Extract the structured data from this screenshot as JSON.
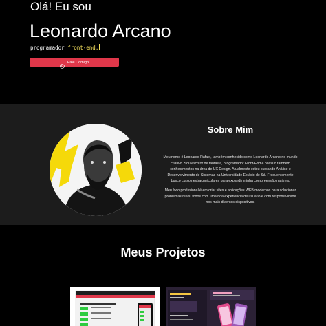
{
  "hero": {
    "greeting": "Olá! Eu sou",
    "name": "Leonardo Arcano",
    "typed_prefix": "programador",
    "typed_value": "front-end.",
    "cta_label": "Fale Comigo",
    "cta_icon": "whatsapp-icon",
    "cta_color": "#e0374a"
  },
  "about": {
    "title": "Sobre Mim",
    "paragraph_1": "Meu nome é Leonardo Rafael, também conhecido como Leonardo Arcano no mundo criativo. Sou escritor de fantasia, programador Front-End e possuo também conhecimentos na área de UX Design. Atualmente estou cursando Análise e Desenvolvimento de Sistemas na Universidade Estácio de Sá. Frequentemente busco cursos extracurriculares para expandir minha compreensão na área.",
    "paragraph_2": "Meu foco profissional é em criar sites e aplicações WEB modernos para solucionar problemas reais, todos com uma boa experiência de usuário e com responsividade nos mais diversos dispositivos.",
    "accent_color": "#f5d90a"
  },
  "projects": {
    "title": "Meus Projetos"
  }
}
